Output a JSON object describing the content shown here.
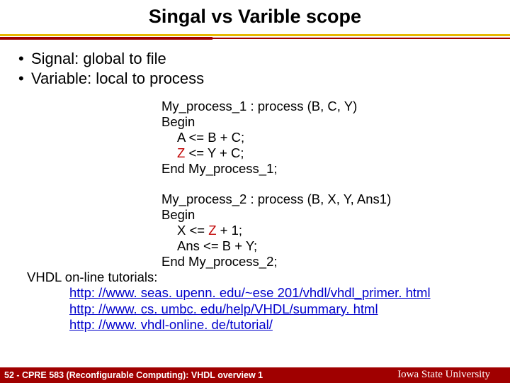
{
  "title": "Singal vs Varible scope",
  "bullets": {
    "b1": "Signal: global to file",
    "b2": "Variable: local to process"
  },
  "code1": {
    "l1": "My_process_1 : process (B, C, Y)",
    "l2": "Begin",
    "l3": "A <= B + C;",
    "l4a": "Z",
    "l4b": " <= Y + C;",
    "l5": "End My_process_1;"
  },
  "code2": {
    "l1": "My_process_2 : process (B, X, Y, Ans1)",
    "l2": "Begin",
    "l3a": "X <= ",
    "l3b": "Z",
    "l3c": " + 1;",
    "l4": "Ans <= B + Y;",
    "l5": "End My_process_2;"
  },
  "tutorials": {
    "lead": "VHDL on-line tutorials:",
    "link1": "http: //www. seas. upenn. edu/~ese 201/vhdl/vhdl_primer. html",
    "link2": "http: //www. cs. umbc. edu/help/VHDL/summary. html",
    "link3": "http: //www. vhdl-online. de/tutorial/"
  },
  "footer": {
    "left": "52 - CPRE 583 (Reconfigurable Computing):  VHDL overview 1",
    "uni": "Iowa State University"
  }
}
